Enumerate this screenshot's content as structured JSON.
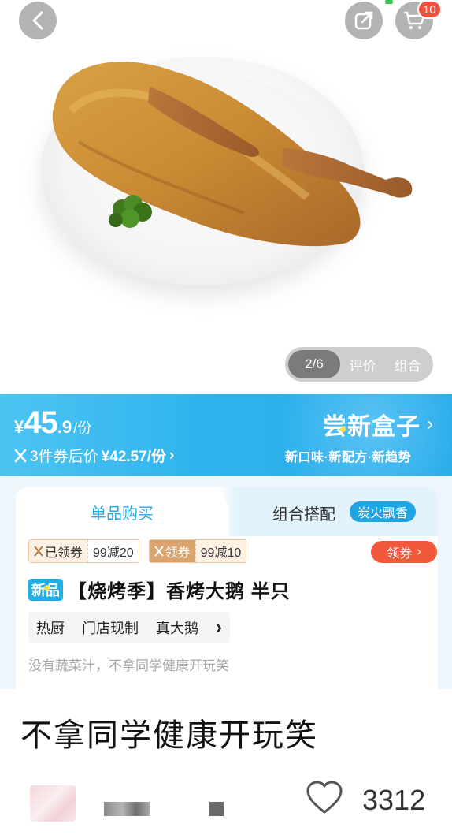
{
  "nav": {
    "back_icon": "chevron-left-icon",
    "share_icon": "share-icon",
    "cart_icon": "cart-icon",
    "cart_badge": "10"
  },
  "gallery": {
    "index": "2/6",
    "tabs": [
      "评价",
      "组合"
    ]
  },
  "price": {
    "currency": "¥",
    "integer": "45",
    "decimal": ".9",
    "unit": "/份",
    "coupon_prefix": "3件券后价",
    "coupon_price": "¥42.57/份",
    "coupon_arrow": "›",
    "color": "#2fb3ee"
  },
  "promo": {
    "title": "尝新盒子",
    "arrow": "›",
    "subtitle": "新口味·新配方·新趋势"
  },
  "card": {
    "tab_single": "单品购买",
    "tab_combo": "组合搭配",
    "combo_tag": "炭火飘香",
    "coupons": [
      {
        "label": "已领券",
        "value": "99减20"
      },
      {
        "label": "领券",
        "value": "99减10"
      }
    ],
    "get_coupon": "领券",
    "get_coupon_arrow": "›",
    "new_badge": "新品",
    "product_title": "【烧烤季】香烤大鹅 半只",
    "features": [
      "热厨",
      "门店现制",
      "真大鹅"
    ],
    "features_arrow": "›",
    "description": "没有蔬菜汁，不拿同学健康开玩笑"
  },
  "post": {
    "title": "不拿同学健康开玩笑",
    "likes": "3312",
    "heart_icon": "heart-outline-icon"
  }
}
